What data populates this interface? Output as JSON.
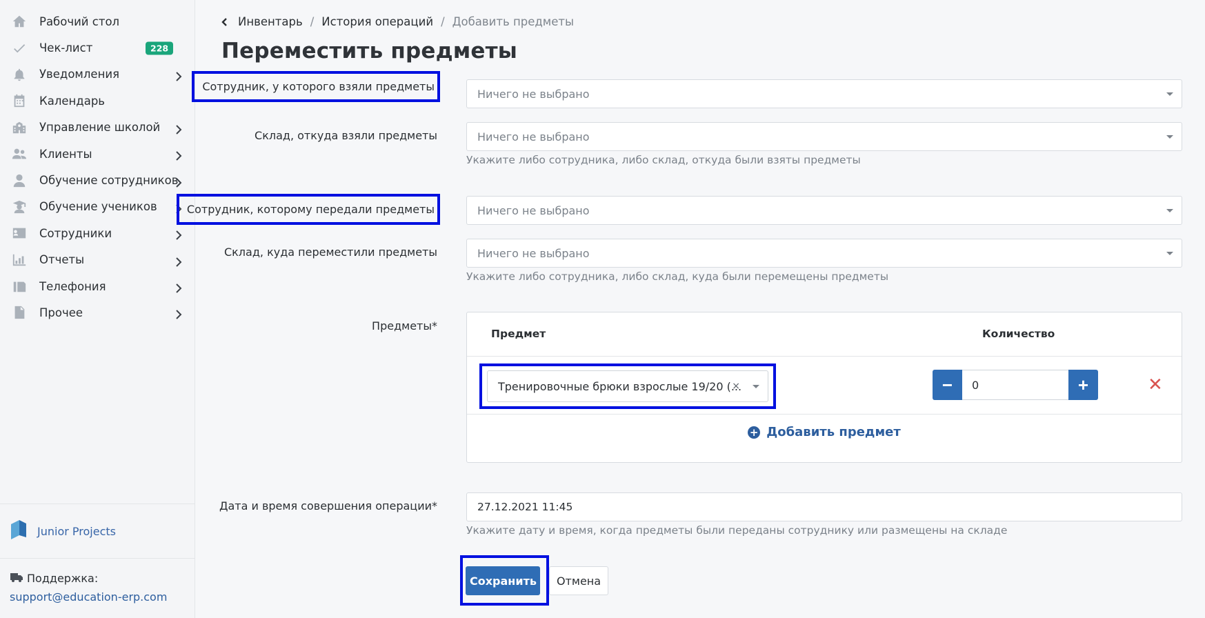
{
  "sidebar": {
    "items": [
      {
        "label": "Рабочий стол",
        "icon": "home-icon",
        "has_chevron": false
      },
      {
        "label": "Чек-лист",
        "icon": "check-icon",
        "has_chevron": false,
        "badge": "228"
      },
      {
        "label": "Уведомления",
        "icon": "bell-icon",
        "has_chevron": true
      },
      {
        "label": "Календарь",
        "icon": "calendar-icon",
        "has_chevron": false
      },
      {
        "label": "Управление школой",
        "icon": "school-icon",
        "has_chevron": true
      },
      {
        "label": "Клиенты",
        "icon": "users-icon",
        "has_chevron": true
      },
      {
        "label": "Обучение сотрудников",
        "icon": "user-tie-icon",
        "has_chevron": true
      },
      {
        "label": "Обучение учеников",
        "icon": "graduate-icon",
        "has_chevron": true
      },
      {
        "label": "Сотрудники",
        "icon": "id-card-icon",
        "has_chevron": true
      },
      {
        "label": "Отчеты",
        "icon": "chart-icon",
        "has_chevron": true
      },
      {
        "label": "Телефония",
        "icon": "fax-icon",
        "has_chevron": true
      },
      {
        "label": "Прочее",
        "icon": "file-icon",
        "has_chevron": true
      }
    ],
    "brand": "Junior Projects",
    "support_label": "Поддержка:",
    "support_email": "support@education-erp.com"
  },
  "breadcrumb": {
    "items": [
      "Инвентарь",
      "История операций"
    ],
    "current": "Добавить предметы"
  },
  "page_title": "Переместить предметы",
  "form": {
    "from_employee_label": "Сотрудник, у которого взяли предметы",
    "from_employee_value": "Ничего не выбрано",
    "from_warehouse_label": "Склад, откуда взяли предметы",
    "from_warehouse_value": "Ничего не выбрано",
    "from_help": "Укажите либо сотрудника, либо склад, откуда были взяты предметы",
    "to_employee_label": "Сотрудник, которому передали предметы",
    "to_employee_value": "Ничего не выбрано",
    "to_warehouse_label": "Склад, куда переместили предметы",
    "to_warehouse_value": "Ничего не выбрано",
    "to_help": "Укажите либо сотрудника, либо склад, куда были перемещены предметы",
    "items_label": "Предметы*",
    "items_table": {
      "col_item": "Предмет",
      "col_qty": "Количество",
      "row": {
        "item": "Тренировочные брюки взрослые 19/20 (...",
        "qty": "0"
      },
      "add_label": "Добавить предмет"
    },
    "datetime_label": "Дата и время совершения операции*",
    "datetime_value": "27.12.2021 11:45",
    "datetime_help": "Укажите дату и время, когда предметы были переданы сотруднику или размещены на складе",
    "save_label": "Сохранить",
    "cancel_label": "Отмена"
  },
  "colors": {
    "accent": "#2f6db5",
    "badge": "#1aa57b",
    "highlight": "#0010e0",
    "danger": "#d9534f"
  }
}
